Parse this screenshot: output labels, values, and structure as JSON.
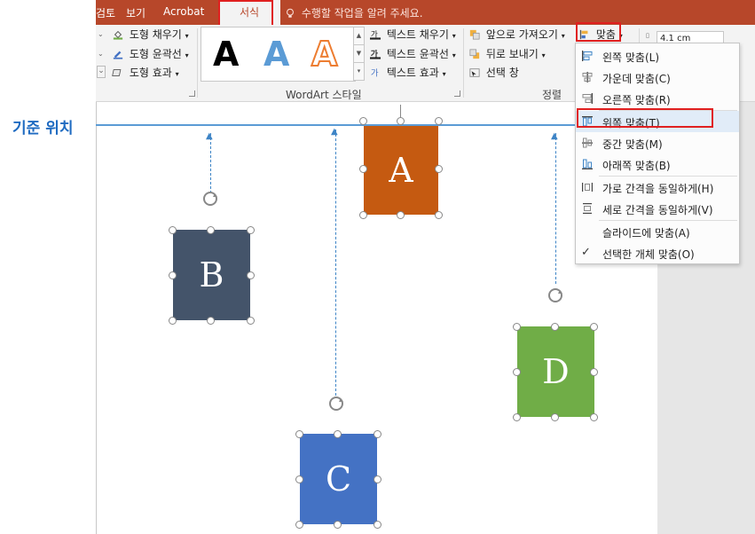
{
  "ribbon": {
    "tabs": [
      "검토",
      "보기",
      "Acrobat"
    ],
    "active_tab": "서식",
    "tell_me": "수행할 작업을 알려 주세요.",
    "shape_group": {
      "fill": "도형 채우기",
      "outline": "도형 윤곽선",
      "effects": "도형 효과"
    },
    "wordart": {
      "letters": [
        "A",
        "A",
        "A"
      ],
      "text_fill": "텍스트 채우기",
      "text_outline": "텍스트 윤곽선",
      "text_effects": "텍스트 효과",
      "group_label": "WordArt 스타일"
    },
    "arrange": {
      "bring_forward": "앞으로 가져오기",
      "send_backward": "뒤로 보내기",
      "selection_pane": "선택 창",
      "align": "맞춤",
      "group_label": "정렬"
    },
    "size_value": "4.1 cm"
  },
  "align_menu": {
    "items": [
      {
        "label": "왼쪽 맞춤(L)",
        "icon": "align-left-icon"
      },
      {
        "label": "가운데 맞춤(C)",
        "icon": "align-center-icon"
      },
      {
        "label": "오른쪽 맞춤(R)",
        "icon": "align-right-icon"
      },
      {
        "label": "위쪽 맞춤(T)",
        "icon": "align-top-icon"
      },
      {
        "label": "중간 맞춤(M)",
        "icon": "align-middle-icon"
      },
      {
        "label": "아래쪽 맞춤(B)",
        "icon": "align-bottom-icon"
      },
      {
        "label": "가로 간격을 동일하게(H)",
        "icon": "distribute-horizontal-icon"
      },
      {
        "label": "세로 간격을 동일하게(V)",
        "icon": "distribute-vertical-icon"
      },
      {
        "label": "슬라이드에 맞춤(A)",
        "icon": ""
      },
      {
        "label": "선택한 개체 맞춤(O)",
        "icon": "checkmark-icon"
      }
    ]
  },
  "annotation": {
    "basis_label": "기준 위치"
  },
  "shapes": [
    {
      "label": "A",
      "color": "#c55a11"
    },
    {
      "label": "B",
      "color": "#44546a"
    },
    {
      "label": "C",
      "color": "#4472c4"
    },
    {
      "label": "D",
      "color": "#70ad47"
    }
  ],
  "colors": {
    "ribbon_tab": "#b7472a",
    "guide_line": "#5b9bd5",
    "highlight": "#e02020",
    "annotation": "#1f6bc1"
  }
}
